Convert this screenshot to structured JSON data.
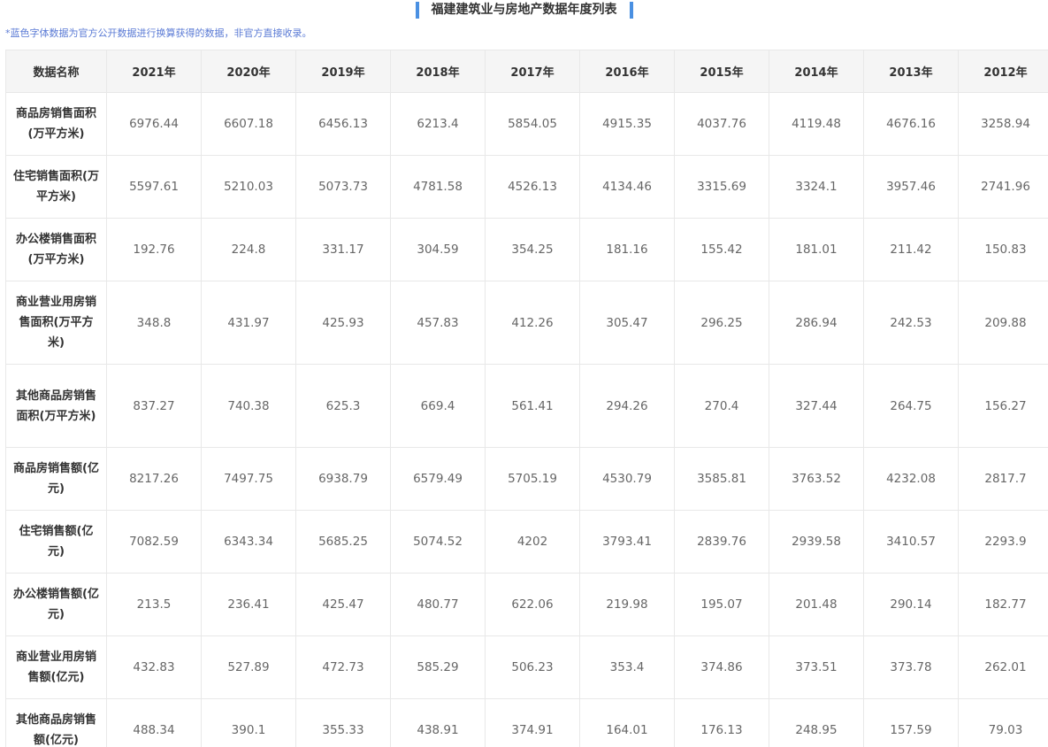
{
  "page": {
    "title": "福建建筑业与房地产数据年度列表",
    "note": "*蓝色字体数据为官方公开数据进行换算获得的数据，非官方直接收录。"
  },
  "table": {
    "header_label": "数据名称",
    "years": [
      "2021年",
      "2020年",
      "2019年",
      "2018年",
      "2017年",
      "2016年",
      "2015年",
      "2014年",
      "2013年",
      "2012年"
    ],
    "rows": [
      {
        "name": "商品房销售面积(万平方米)",
        "values": [
          "6976.44",
          "6607.18",
          "6456.13",
          "6213.4",
          "5854.05",
          "4915.35",
          "4037.76",
          "4119.48",
          "4676.16",
          "3258.94"
        ]
      },
      {
        "name": "住宅销售面积(万平方米)",
        "values": [
          "5597.61",
          "5210.03",
          "5073.73",
          "4781.58",
          "4526.13",
          "4134.46",
          "3315.69",
          "3324.1",
          "3957.46",
          "2741.96"
        ]
      },
      {
        "name": "办公楼销售面积(万平方米)",
        "values": [
          "192.76",
          "224.8",
          "331.17",
          "304.59",
          "354.25",
          "181.16",
          "155.42",
          "181.01",
          "211.42",
          "150.83"
        ]
      },
      {
        "name": "商业营业用房销售面积(万平方米)",
        "values": [
          "348.8",
          "431.97",
          "425.93",
          "457.83",
          "412.26",
          "305.47",
          "296.25",
          "286.94",
          "242.53",
          "209.88"
        ]
      },
      {
        "name": "其他商品房销售面积(万平方米)",
        "values": [
          "837.27",
          "740.38",
          "625.3",
          "669.4",
          "561.41",
          "294.26",
          "270.4",
          "327.44",
          "264.75",
          "156.27"
        ]
      },
      {
        "name": "商品房销售额(亿元)",
        "values": [
          "8217.26",
          "7497.75",
          "6938.79",
          "6579.49",
          "5705.19",
          "4530.79",
          "3585.81",
          "3763.52",
          "4232.08",
          "2817.7"
        ]
      },
      {
        "name": "住宅销售额(亿元)",
        "values": [
          "7082.59",
          "6343.34",
          "5685.25",
          "5074.52",
          "4202",
          "3793.41",
          "2839.76",
          "2939.58",
          "3410.57",
          "2293.9"
        ]
      },
      {
        "name": "办公楼销售额(亿元)",
        "values": [
          "213.5",
          "236.41",
          "425.47",
          "480.77",
          "622.06",
          "219.98",
          "195.07",
          "201.48",
          "290.14",
          "182.77"
        ]
      },
      {
        "name": "商业营业用房销售额(亿元)",
        "values": [
          "432.83",
          "527.89",
          "472.73",
          "585.29",
          "506.23",
          "353.4",
          "374.86",
          "373.51",
          "373.78",
          "262.01"
        ]
      },
      {
        "name": "其他商品房销售额(亿元)",
        "values": [
          "488.34",
          "390.1",
          "355.33",
          "438.91",
          "374.91",
          "164.01",
          "176.13",
          "248.95",
          "157.59",
          "79.03"
        ]
      }
    ]
  }
}
